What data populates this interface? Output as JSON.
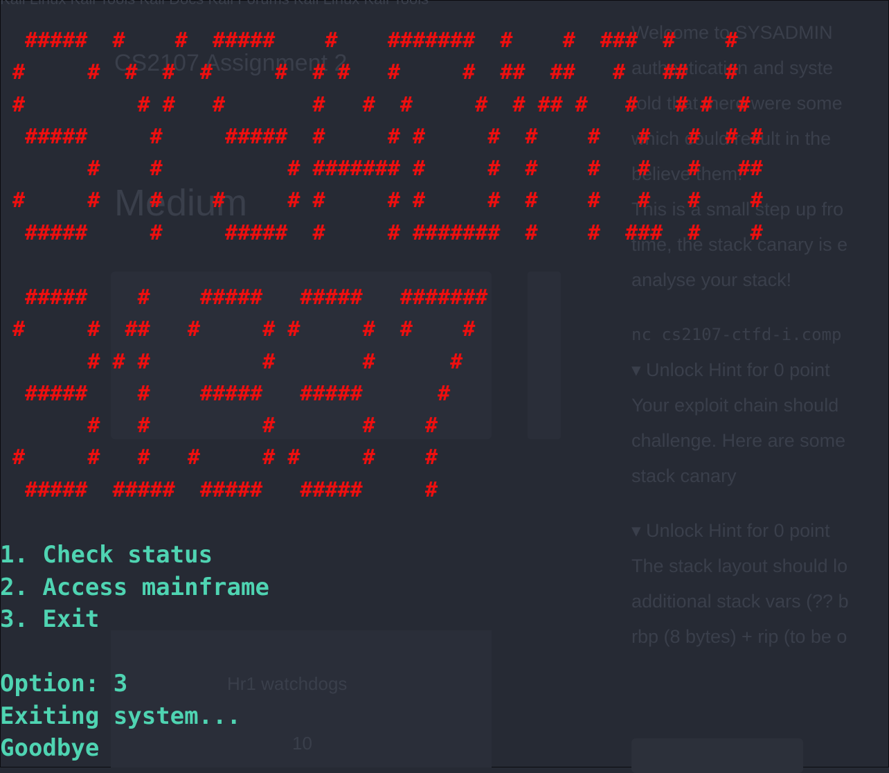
{
  "background_page": {
    "tabs": "Kali Linux    Kali Tools    Kali Docs    Kali Forums    Kali Linux    Kali Tools",
    "title": "CS2107 Assignment 2",
    "difficulty": "Medium",
    "card_label": "Hr1 watchdogs",
    "card_value": "10",
    "description_lines": [
      "Welcome to SYSADMIN",
      "authentication and syste",
      "told that there were some",
      "which could result in the",
      "believe them!",
      "",
      "This is a small step up fro",
      "time, the stack canary is e",
      "analyse your stack!"
    ],
    "command": "nc cs2107-ctfd-i.comp",
    "hint1_title": "▾ Unlock Hint for 0 point",
    "hint1_lines": [
      "Your exploit chain should",
      "challenge. Here are some",
      "stack canary"
    ],
    "hint2_title": "▾ Unlock Hint for 0 point",
    "hint2_lines": [
      "The stack layout should lo",
      "additional stack vars (?? b",
      "rbp (8 bytes) + rip (to be o"
    ]
  },
  "terminal": {
    "banner_color": "#ee0f0f",
    "text_color": "#4fd4b2",
    "banner_line1": [
      " #####  #    #  #####    #    #######  #    #  ###  #    #",
      "#     #  #  #  #     #  # #   #     #  ##  ##   #   ##   #",
      "#         # #   #       #   #  #     #  # ## #   #   # #  #",
      " #####     #     #####  #     # #     #  #    #   #   #  # #",
      "      #    #          # ####### #     #  #    #   #   #   ##",
      "#     #    #    #     # #     # #     #  #    #   #   #    #",
      " #####     #     #####  #     # #######  #    #  ###  #    #"
    ],
    "banner_line2": [
      " #####    #    #####   #####   #######",
      "#     #  ##   #     # #     #  #    #",
      "      # # #         #       #      #",
      " #####    #    #####   #####      #",
      "      #   #         #       #    #",
      "#     #   #   #     # #     #    #",
      " #####  #####  #####   #####     #"
    ],
    "menu_items": [
      "1. Check status",
      "2. Access mainframe",
      "3. Exit"
    ],
    "prompt_label": "Option: ",
    "prompt_value": "3",
    "exit_message": "Exiting system...",
    "goodbye": "Goodbye"
  }
}
